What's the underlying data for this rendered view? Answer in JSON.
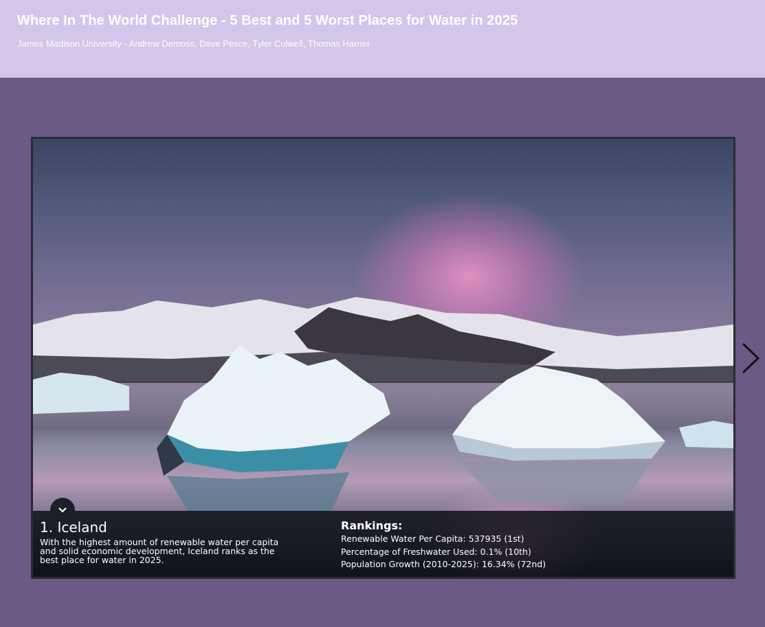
{
  "header": {
    "title": "Where In The World Challenge - 5 Best and 5 Worst Places for Water in 2025",
    "subtitle": "James Madison University - Andrew Demoss, Dave Pesce, Tyler Colwell, Thomas Harner"
  },
  "slide": {
    "title": "1. Iceland",
    "description": "With the highest amount of renewable water per capita and solid economic development, Iceland ranks as the best place for water in 2025.",
    "rankings_heading": "Rankings:",
    "rankings": [
      "Renewable Water Per Capita: 537935 (1st)",
      "Percentage of Freshwater Used: 0.1% (10th)",
      "Population Growth (2010-2025): 16.34% (72nd)"
    ]
  },
  "icons": {
    "toggle": "chevron-down-icon",
    "next": "chevron-right-icon"
  },
  "colors": {
    "header_bg": "#d3c6ea",
    "page_bg": "#6b5a86",
    "panel_bg": "#0a0c14"
  }
}
